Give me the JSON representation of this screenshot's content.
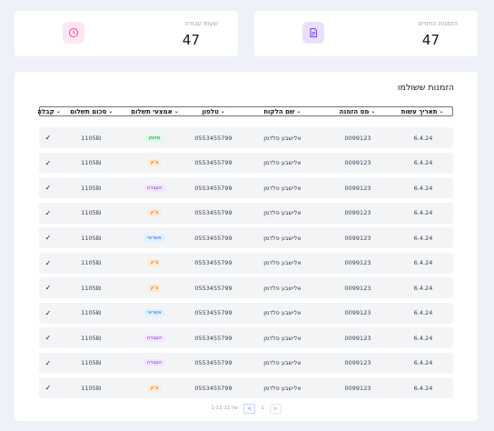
{
  "stats": {
    "hours": {
      "label": "שעות עבודה",
      "value": "47",
      "icon": "clock-icon",
      "color": "#ec4899"
    },
    "orders": {
      "label": "הזמנות החודש",
      "value": "47",
      "icon": "document-icon",
      "color": "#7c3aed"
    }
  },
  "table": {
    "title": "הזמנות ששולמו",
    "headers": [
      "תאריך עשות",
      "מס הזמנה",
      "שם הלקוח",
      "טלפון",
      "אמצעי תשלום",
      "סכום תשלום",
      "קבלה"
    ],
    "rows": [
      {
        "date": "6.4.24",
        "order": "0099123",
        "client": "אלישבע פלדמן",
        "phone": "0553455799",
        "pay": "מזומן",
        "pay_kind": "cash",
        "sum": "1105₪"
      },
      {
        "date": "6.4.24",
        "order": "0099123",
        "client": "אלישבע פלדמן",
        "phone": "0553455799",
        "pay": "צ'ק",
        "pay_kind": "cheque",
        "sum": "1105₪"
      },
      {
        "date": "6.4.24",
        "order": "0099123",
        "client": "אלישבע פלדמן",
        "phone": "0553455799",
        "pay": "העברה",
        "pay_kind": "transfer",
        "sum": "1105₪"
      },
      {
        "date": "6.4.24",
        "order": "0099123",
        "client": "אלישבע פלדמן",
        "phone": "0553455799",
        "pay": "צ'ק",
        "pay_kind": "cheque",
        "sum": "1105₪"
      },
      {
        "date": "6.4.24",
        "order": "0099123",
        "client": "אלישבע פלדמן",
        "phone": "0553455799",
        "pay": "אשראי",
        "pay_kind": "credit",
        "sum": "1105₪"
      },
      {
        "date": "6.4.24",
        "order": "0099123",
        "client": "אלישבע פלדמן",
        "phone": "0553455799",
        "pay": "צ'ק",
        "pay_kind": "cheque",
        "sum": "1105₪"
      },
      {
        "date": "6.4.24",
        "order": "0099123",
        "client": "אלישבע פלדמן",
        "phone": "0553455799",
        "pay": "צ'ק",
        "pay_kind": "cheque",
        "sum": "1105₪"
      },
      {
        "date": "6.4.24",
        "order": "0099123",
        "client": "אלישבע פלדמן",
        "phone": "0553455799",
        "pay": "אשראי",
        "pay_kind": "credit",
        "sum": "1105₪"
      },
      {
        "date": "6.4.24",
        "order": "0099123",
        "client": "אלישבע פלדמן",
        "phone": "0553455799",
        "pay": "העברה",
        "pay_kind": "transfer",
        "sum": "1105₪"
      },
      {
        "date": "6.4.24",
        "order": "0099123",
        "client": "אלישבע פלדמן",
        "phone": "0553455799",
        "pay": "העברה",
        "pay_kind": "transfer",
        "sum": "1105₪"
      },
      {
        "date": "6.4.24",
        "order": "0099123",
        "client": "אלישבע פלדמן",
        "phone": "0553455799",
        "pay": "צ'ק",
        "pay_kind": "cheque",
        "sum": "1105₪"
      }
    ]
  },
  "pagination": {
    "range": "1-11 של 11",
    "page": "1",
    "prev": "<",
    "next": ">"
  },
  "check_glyph": "✓"
}
